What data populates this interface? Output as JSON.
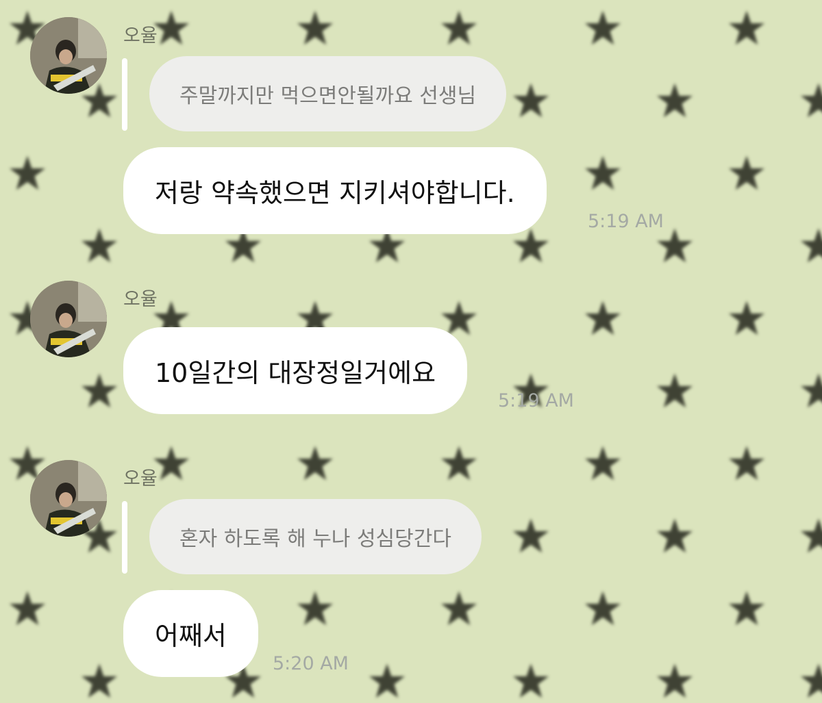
{
  "colors": {
    "wallpaper": "#dbe4bd",
    "star": "#3f4234",
    "bubble": "#ffffff",
    "reply_bubble": "#eeeeec",
    "timestamp": "#a4a9a4"
  },
  "wallpaper": {
    "pattern": "star-icon"
  },
  "chat": {
    "groups": [
      {
        "sender": "오율",
        "reply_quote": "주말까지만 먹으면안될까요 선생님",
        "message": "저랑 약속했으면 지키셔야합니다.",
        "time": "5:19 AM"
      },
      {
        "sender": "오율",
        "message": "10일간의 대장정일거에요",
        "time": "5:19 AM"
      },
      {
        "sender": "오율",
        "reply_quote": "혼자 하도록 해 누나 성심당간다",
        "message": "어째서",
        "time": "5:20 AM"
      }
    ]
  }
}
